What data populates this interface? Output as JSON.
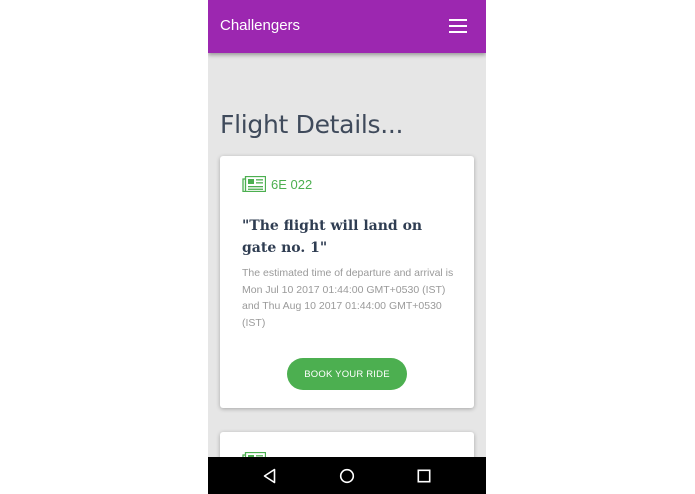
{
  "appbar": {
    "title": "Challengers",
    "menu_icon": "menu-icon"
  },
  "page": {
    "title": "Flight Details..."
  },
  "cards": [
    {
      "icon": "newspaper-icon",
      "flight_number": "6E 022",
      "heading": "\"The flight will land on gate no. 1\"",
      "description": "The estimated time of departure and arrival is Mon Jul 10 2017 01:44:00 GMT+0530 (IST) and Thu Aug 10 2017 01:44:00 GMT+0530 (IST)",
      "button_label": "BOOK YOUR RIDE"
    },
    {
      "icon": "newspaper-icon"
    }
  ],
  "navbar": {
    "back_icon": "back-icon",
    "home_icon": "home-icon",
    "recents_icon": "recents-icon"
  },
  "colors": {
    "primary": "#9c27b0",
    "accent": "#4caf50",
    "background": "#e6e6e6",
    "title_text": "#3f4a5b"
  }
}
